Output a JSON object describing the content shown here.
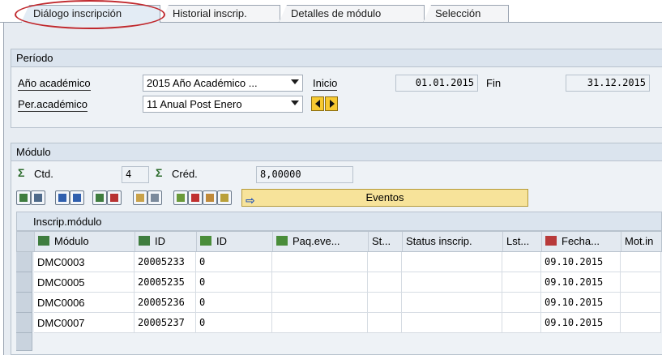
{
  "tabs": [
    {
      "label": "Diálogo inscripción",
      "active": true
    },
    {
      "label": "Historial inscrip.",
      "active": false
    },
    {
      "label": "Detalles de módulo",
      "active": false
    },
    {
      "label": "Selección",
      "active": false
    }
  ],
  "periodo": {
    "title": "Período",
    "ano_label": "Año académico",
    "ano_value": "2015 Año Académico ...",
    "inicio_label": "Inicio",
    "inicio_value": "01.01.2015",
    "fin_label": "Fin",
    "fin_value": "31.12.2015",
    "per_label": "Per.académico",
    "per_value": "11 Anual Post Enero"
  },
  "modulo": {
    "title": "Módulo",
    "ctd_label": "Ctd.",
    "ctd_value": "4",
    "cred_label": "Créd.",
    "cred_value": "8,00000",
    "eventos_label": "Eventos"
  },
  "table": {
    "title": "Inscrip.módulo",
    "columns": [
      "Módulo",
      "ID",
      "ID",
      "Paq.eve...",
      "St...",
      "Status inscrip.",
      "Lst...",
      "Fecha...",
      "Mot.in"
    ],
    "rows": [
      {
        "modulo": "DMC0003",
        "id": "20005233",
        "id2": "0",
        "fecha": "09.10.2015"
      },
      {
        "modulo": "DMC0005",
        "id": "20005235",
        "id2": "0",
        "fecha": "09.10.2015"
      },
      {
        "modulo": "DMC0006",
        "id": "20005236",
        "id2": "0",
        "fecha": "09.10.2015"
      },
      {
        "modulo": "DMC0007",
        "id": "20005237",
        "id2": "0",
        "fecha": "09.10.2015"
      }
    ]
  },
  "colors": {
    "highlight": "#c0282d",
    "button_yellow": "#f7e39a",
    "accent_green": "#2c6b2c"
  }
}
